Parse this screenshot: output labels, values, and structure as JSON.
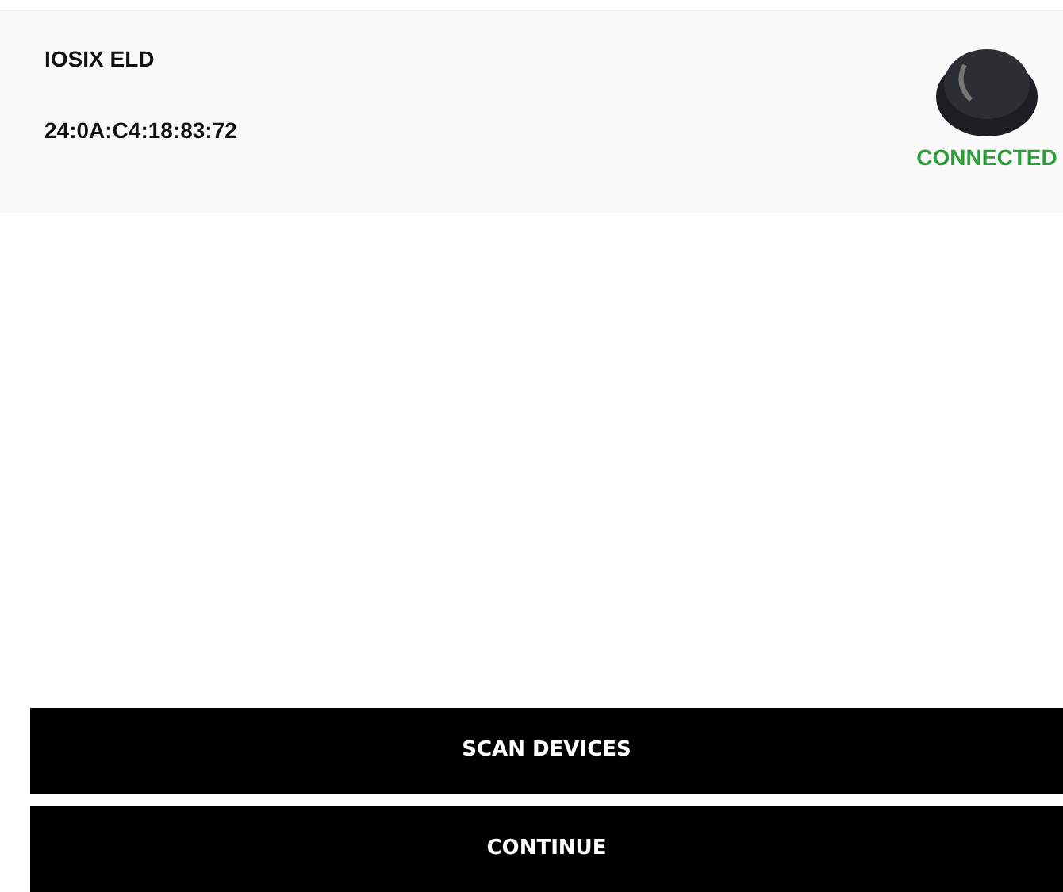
{
  "device": {
    "name": "IOSIX ELD",
    "address": "24:0A:C4:18:83:72",
    "status": "CONNECTED"
  },
  "buttons": [
    {
      "label": "SCAN DEVICES"
    },
    {
      "label": "CONTINUE"
    }
  ]
}
